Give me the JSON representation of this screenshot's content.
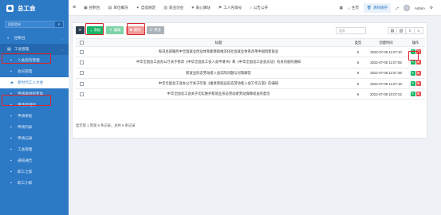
{
  "app": {
    "title": "总工会"
  },
  "sidebar": {
    "search_placeholder": "搜索菜单",
    "items": [
      {
        "label": "控制台",
        "icon": "dashboard-icon",
        "level": 0,
        "state": "normal"
      },
      {
        "label": "工会管理",
        "icon": "menu-icon",
        "level": 0,
        "state": "open"
      },
      {
        "label": "入会后的管理",
        "icon": "list-icon",
        "level": 1,
        "state": "normal"
      },
      {
        "label": "会员管理",
        "icon": "list-icon",
        "level": 1,
        "state": "normal"
      },
      {
        "label": "新时代工人大会",
        "icon": "folder-icon",
        "level": 1,
        "state": "active"
      },
      {
        "label": "申请单组织变动",
        "icon": "list-icon",
        "level": 1,
        "state": "normal"
      },
      {
        "label": "申请单组织",
        "icon": "list-icon",
        "level": 1,
        "state": "normal"
      },
      {
        "label": "申请审批",
        "icon": "list-icon",
        "level": 1,
        "state": "normal"
      },
      {
        "label": "申请列表",
        "icon": "list-icon",
        "level": 1,
        "state": "normal"
      },
      {
        "label": "申请记录",
        "icon": "list-icon",
        "level": 1,
        "state": "normal"
      },
      {
        "label": "工会管理",
        "icon": "list-icon",
        "level": 1,
        "state": "normal"
      },
      {
        "label": "通知通告",
        "icon": "list-icon",
        "level": 1,
        "state": "normal"
      },
      {
        "label": "职工之家",
        "icon": "list-icon",
        "level": 1,
        "state": "normal"
      },
      {
        "label": "职工小家",
        "icon": "list-icon",
        "level": 1,
        "state": "normal"
      }
    ]
  },
  "topbar": {
    "nav": [
      {
        "label": "控制台",
        "icon": "home-icon"
      },
      {
        "label": "单位概况",
        "icon": "doc-icon"
      },
      {
        "label": "自选规定",
        "icon": "star-icon"
      },
      {
        "label": "就业创业",
        "icon": "briefcase-icon"
      },
      {
        "label": "爱心驿站",
        "icon": "heart-icon"
      },
      {
        "label": "工人先锋号",
        "icon": "flag-icon"
      },
      {
        "label": "公告公开",
        "icon": "bell-icon"
      }
    ],
    "right": {
      "home_label": "主页",
      "clear_label": "清除缓存",
      "user_name": "Admin"
    }
  },
  "toolbar": {
    "add_label": "添加",
    "edit_label": "编辑",
    "delete_label": "删除",
    "more_label": "更多"
  },
  "search": {
    "placeholder": "搜索"
  },
  "table": {
    "headers": {
      "title": "标题",
      "type": "类型",
      "time": "创建时间",
      "op": "操作"
    },
    "rows": [
      {
        "title": "每日总部服务中全国就业创业体系能够助推深化社会就业体系改革中国创新就业",
        "type": "6",
        "time": "2022-07-08 11:07:10"
      },
      {
        "title": "中华全国总工会办公厅关于修改《中华全国总工会入会申请书》和《中华全国总工会会员证》有关内容的通知",
        "type": "6",
        "time": "2022-07-08 11:07:55"
      },
      {
        "title": "新就业形态劳动者入会实际问题与对策解答",
        "type": "6",
        "time": "2022-07-08 11:07:39"
      },
      {
        "title": "中华全国总工会办公厅关于印发《推进新就业形态劳动者入会工作方案》的通知",
        "type": "6",
        "time": "2022-07-08 11:07:18"
      },
      {
        "title": "中华全国总工会关于切实维护新就业形态劳动者劳动保障权益的意见",
        "type": "6",
        "time": "2022-07-08 10:07:22"
      }
    ]
  },
  "footer": {
    "summary": "显示第 1 到第 5 条记录，总共 5 条记录"
  },
  "colors": {
    "sidebar": "#2c79c6",
    "add": "#18b566",
    "delete": "#e8524f",
    "highlight": "#d9262c"
  }
}
